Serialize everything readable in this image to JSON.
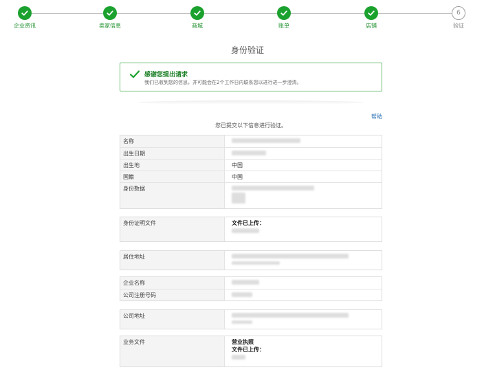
{
  "stepper": {
    "steps": [
      {
        "label": "企业资讯",
        "state": "done"
      },
      {
        "label": "卖家信息",
        "state": "done"
      },
      {
        "label": "商城",
        "state": "done"
      },
      {
        "label": "账单",
        "state": "done"
      },
      {
        "label": "店铺",
        "state": "done"
      },
      {
        "label": "验证",
        "state": "pending",
        "number": "6"
      }
    ]
  },
  "page_title": "身份验证",
  "success": {
    "title": "感谢您提出请求",
    "message": "我们已收到您的信息，并可能会在2个工作日内联系您以进行进一步澄清。"
  },
  "help_link": "帮助",
  "intro_text": "您已提交以下信息进行验证。",
  "personal": {
    "name_label": "名称",
    "dob_label": "出生日期",
    "birthplace_label": "出生地",
    "birthplace_value": "中国",
    "nationality_label": "国籍",
    "nationality_value": "中国",
    "id_data_label": "身份数据"
  },
  "id_doc": {
    "label": "身份证明文件",
    "status": "文件已上传："
  },
  "residence": {
    "label": "居住地址"
  },
  "company": {
    "name_label": "企业名称",
    "reg_label": "公司注册号码"
  },
  "company_address": {
    "label": "公司地址"
  },
  "business_docs": {
    "label": "业务文件",
    "doc_type": "营业执照",
    "status": "文件已上传："
  },
  "colors": {
    "accent_green": "#1ba12e",
    "link_blue": "#2a6fb5"
  }
}
